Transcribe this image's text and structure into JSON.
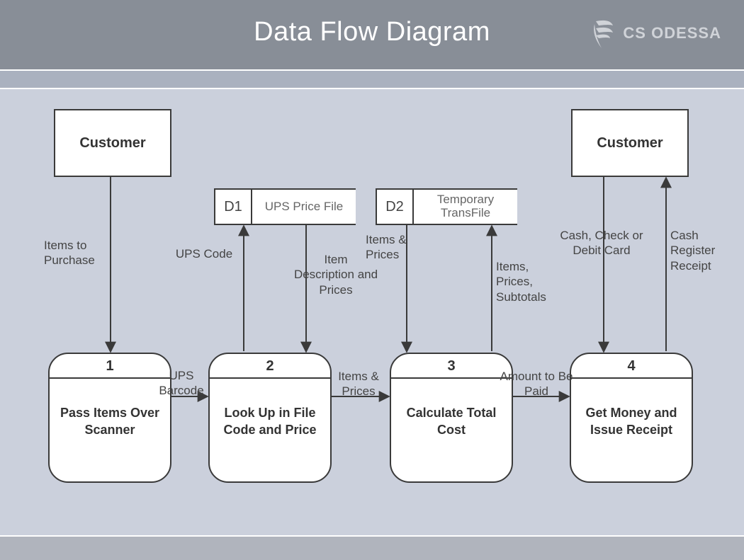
{
  "header": {
    "title": "Data Flow Diagram",
    "brand": "CS ODESSA"
  },
  "entities": {
    "customer_left": "Customer",
    "customer_right": "Customer"
  },
  "stores": {
    "d1": {
      "id": "D1",
      "label": "UPS Price File"
    },
    "d2": {
      "id": "D2",
      "label": "Temporary TransFile"
    }
  },
  "processes": {
    "p1": {
      "id": "1",
      "label": "Pass Items Over Scanner"
    },
    "p2": {
      "id": "2",
      "label": "Look Up in File Code and Price"
    },
    "p3": {
      "id": "3",
      "label": "Calculate Total Cost"
    },
    "p4": {
      "id": "4",
      "label": "Get Money and Issue Receipt"
    }
  },
  "flows": {
    "items_to_purchase": "Items to Purchase",
    "ups_barcode": "UPS Barcode",
    "ups_code": "UPS Code",
    "item_desc_prices": "Item Description and Prices",
    "items_prices_1": "Items & Prices",
    "items_prices_2": "Items & Prices",
    "items_prices_subtotals": "Items, Prices, Subtotals",
    "amount_to_be_paid": "Amount to Be Paid",
    "cash_check_debit": "Cash, Check or Debit Card",
    "cash_register_receipt": "Cash Register Receipt"
  }
}
